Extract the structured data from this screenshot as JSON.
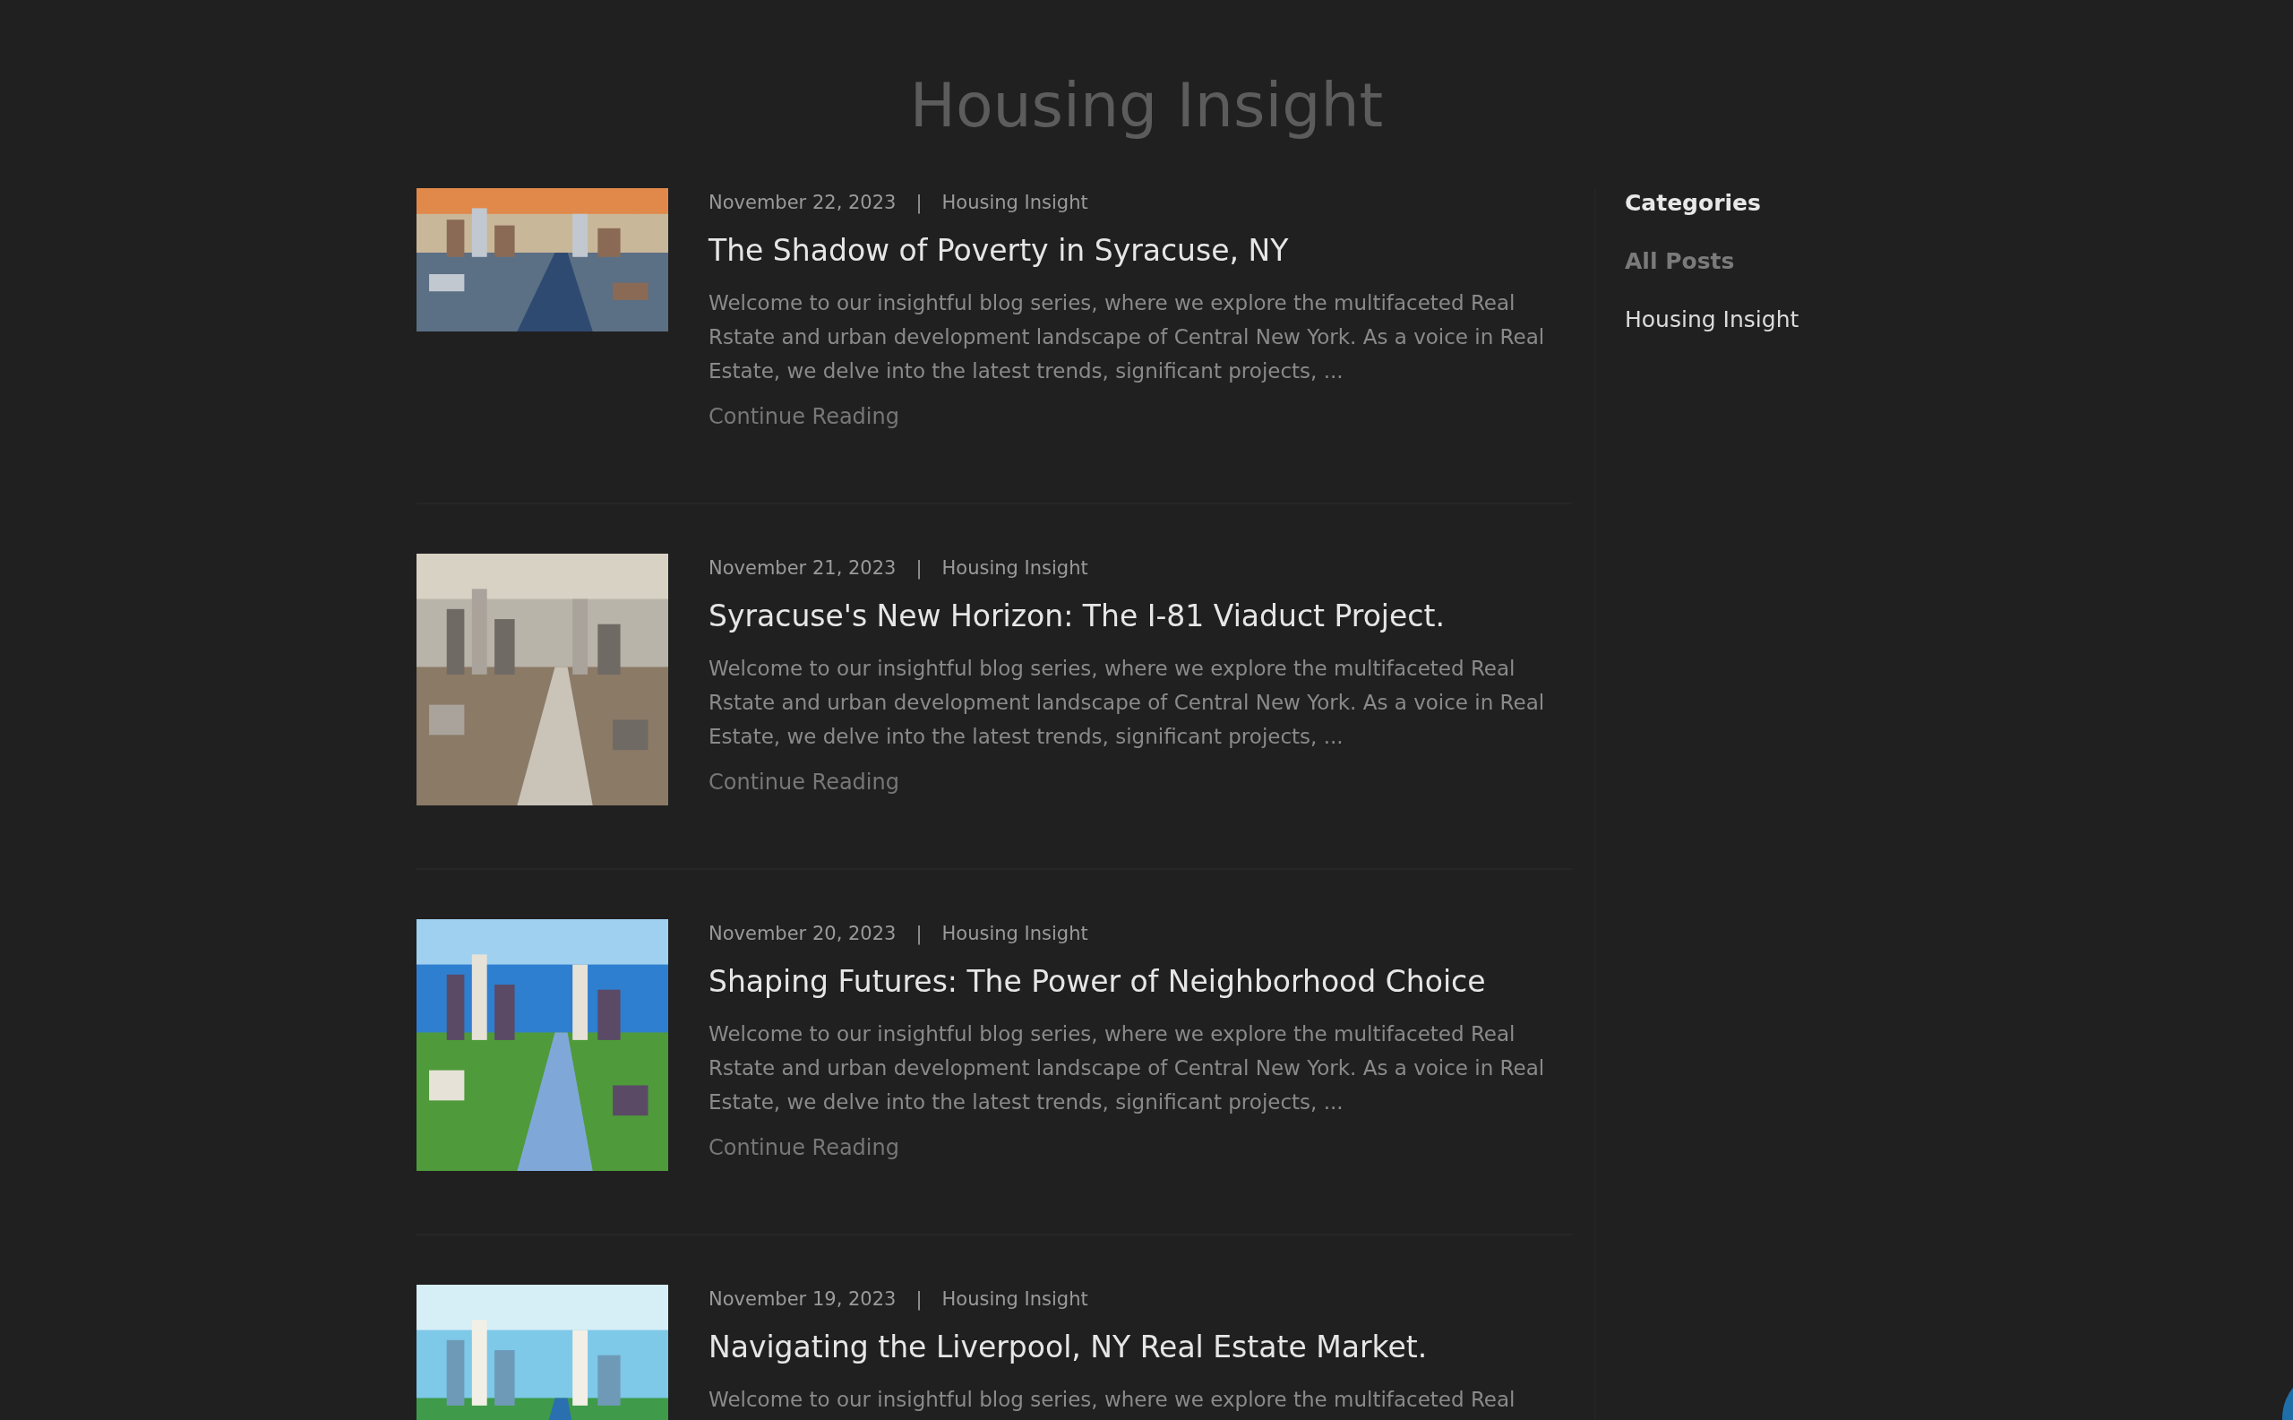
{
  "blog_title": "Housing Insight",
  "posts": [
    {
      "date": "November 22, 2023",
      "separator": "|",
      "category": "Housing Insight",
      "title": "The Shadow of Poverty in Syracuse, NY",
      "excerpt": "Welcome to our insightful blog series, where we explore the multifaceted Real Rstate and urban development landscape of Central New York. As a voice in Real Estate, we delve into the latest trends, significant projects, ...",
      "link": "Continue Reading"
    },
    {
      "date": "November 21, 2023",
      "separator": "|",
      "category": "Housing Insight",
      "title": "Syracuse's New Horizon: The I-81 Viaduct Project.",
      "excerpt": "Welcome to our insightful blog series, where we explore the multifaceted Real Rstate and urban development landscape of Central New York. As a voice in Real Estate, we delve into the latest trends, significant projects, ...",
      "link": "Continue Reading"
    },
    {
      "date": "November 20, 2023",
      "separator": "|",
      "category": "Housing Insight",
      "title": "Shaping Futures: The Power of Neighborhood Choice",
      "excerpt": "Welcome to our insightful blog series, where we explore the multifaceted Real Rstate and urban development landscape of Central New York. As a voice in Real Estate, we delve into the latest trends, significant projects, ...",
      "link": "Continue Reading"
    },
    {
      "date": "November 19, 2023",
      "separator": "|",
      "category": "Housing Insight",
      "title": "Navigating the Liverpool, NY Real Estate Market.",
      "excerpt": "Welcome to our insightful blog series, where we explore the multifaceted Real"
    }
  ],
  "sidebar": {
    "heading": "Categories",
    "items": [
      {
        "label": "All Posts",
        "selected": true
      },
      {
        "label": "Housing Insight",
        "selected": false
      }
    ]
  }
}
